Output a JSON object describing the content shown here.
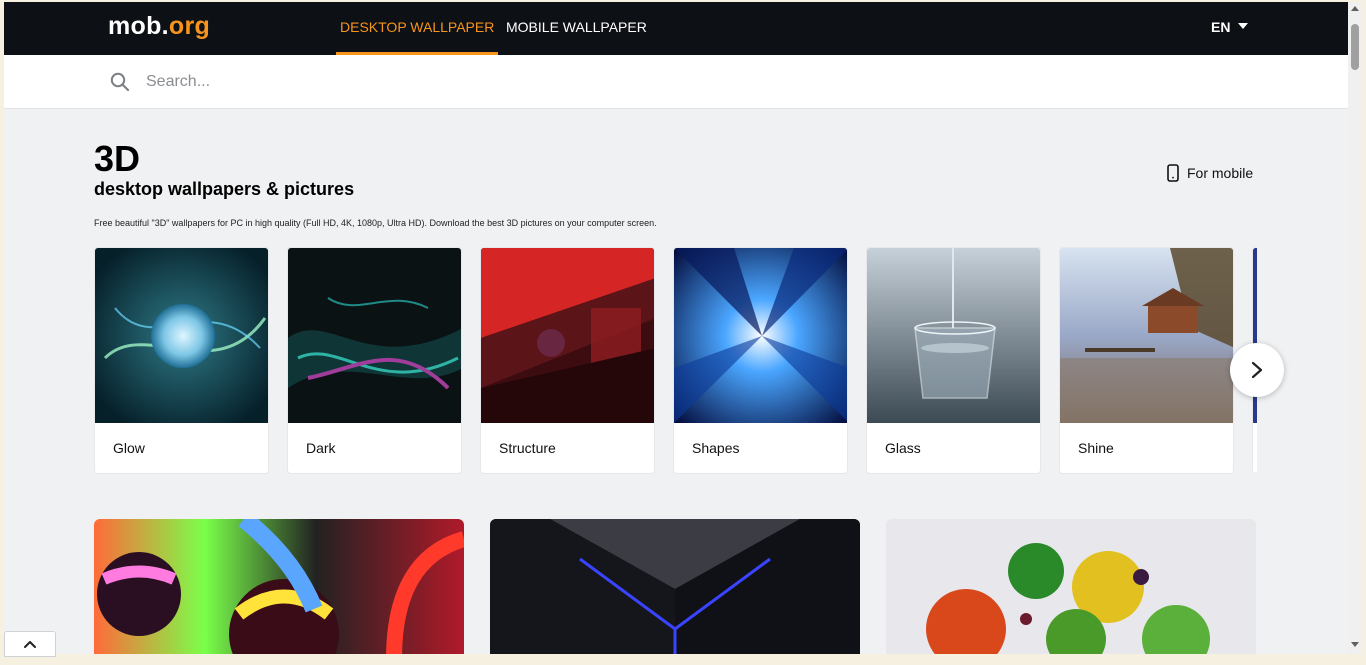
{
  "header": {
    "logo_main": "mob",
    "logo_dot": ".",
    "logo_suffix": "org",
    "tabs": [
      {
        "label": "DESKTOP WALLPAPER",
        "active": true
      },
      {
        "label": "MOBILE WALLPAPER",
        "active": false
      }
    ],
    "language": "EN"
  },
  "search": {
    "placeholder": "Search..."
  },
  "page": {
    "title": "3D",
    "subtitle": "desktop wallpapers & pictures",
    "description": "Free beautiful \"3D\" wallpapers for PC in high quality (Full HD, 4K, 1080p, Ultra HD). Download the best 3D pictures on your computer screen.",
    "for_mobile_label": "For mobile"
  },
  "categories": [
    {
      "label": "Glow"
    },
    {
      "label": "Dark"
    },
    {
      "label": "Structure"
    },
    {
      "label": "Shapes"
    },
    {
      "label": "Glass"
    },
    {
      "label": "Shine"
    }
  ],
  "icons": {
    "search": "search-icon",
    "phone": "phone-icon",
    "next": "chevron-right-icon",
    "back_to_top": "chevron-up-icon"
  },
  "colors": {
    "accent": "#f7941d",
    "header_bg": "#0d1014",
    "page_bg": "#f0f1f3"
  }
}
